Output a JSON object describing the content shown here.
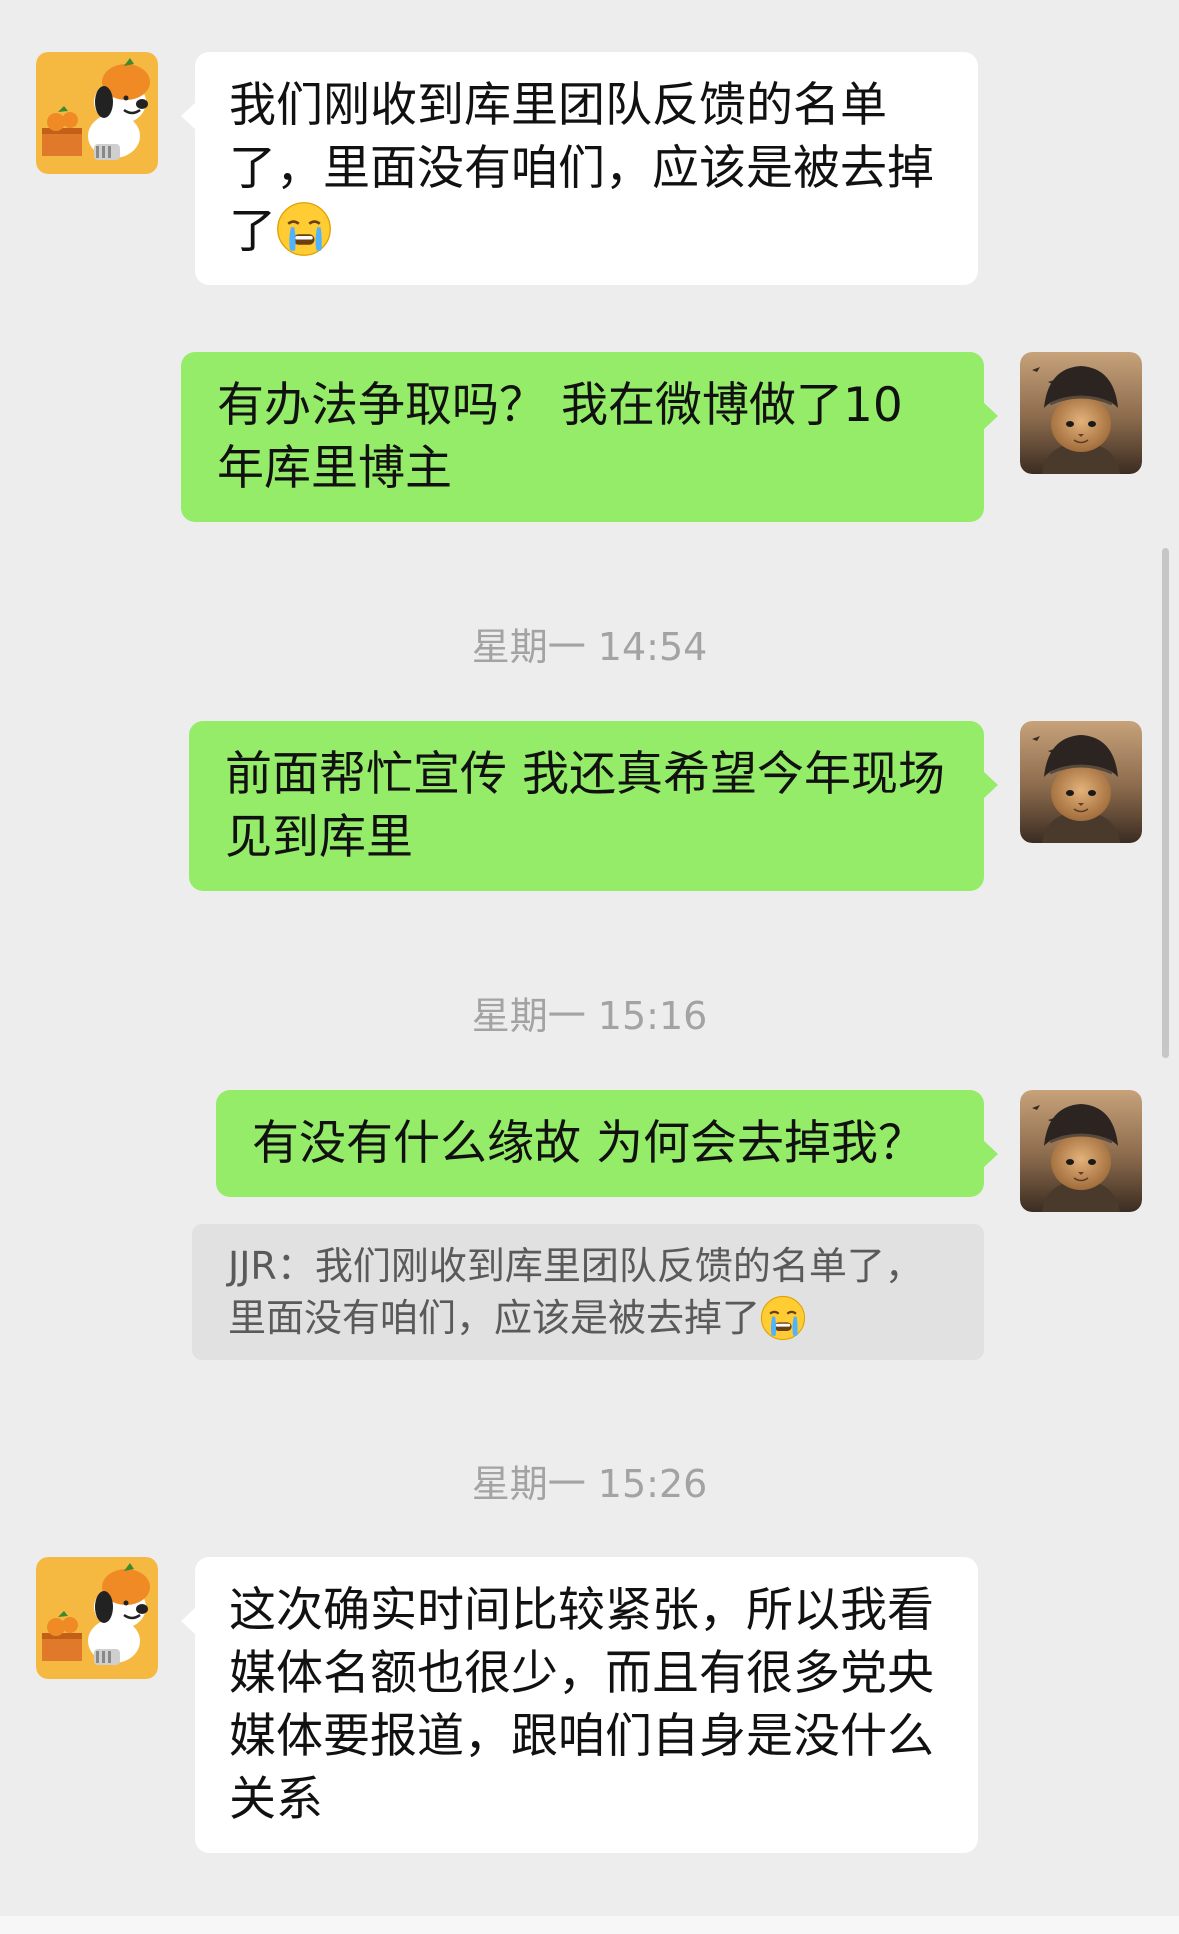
{
  "messages": [
    {
      "text": "我们刚收到库里团队反馈的名单了，里面没有咱们，应该是被去掉了",
      "emoji": "crying-face"
    },
    {
      "text": "有办法争取吗？ 我在微博做了10年库里博主"
    },
    {
      "text": "前面帮忙宣传 我还真希望今年现场见到库里"
    },
    {
      "text": "有没有什么缘故 为何会去掉我？"
    },
    {
      "text": "这次确实时间比较紧张，所以我看媒体名额也很少，而且有很多党央媒体要报道，跟咱们自身是没什么关系"
    }
  ],
  "quote": {
    "text": "JJR：我们刚收到库里团队反馈的名单了，里面没有咱们，应该是被去掉了",
    "emoji": "crying-face"
  },
  "timestamps": [
    "星期一 14:54",
    "星期一 15:16",
    "星期一 15:26"
  ],
  "colors": {
    "background": "#ededed",
    "sent_bubble": "#95ec69",
    "received_bubble": "#ffffff",
    "quote_bg": "#e1e1e1"
  }
}
